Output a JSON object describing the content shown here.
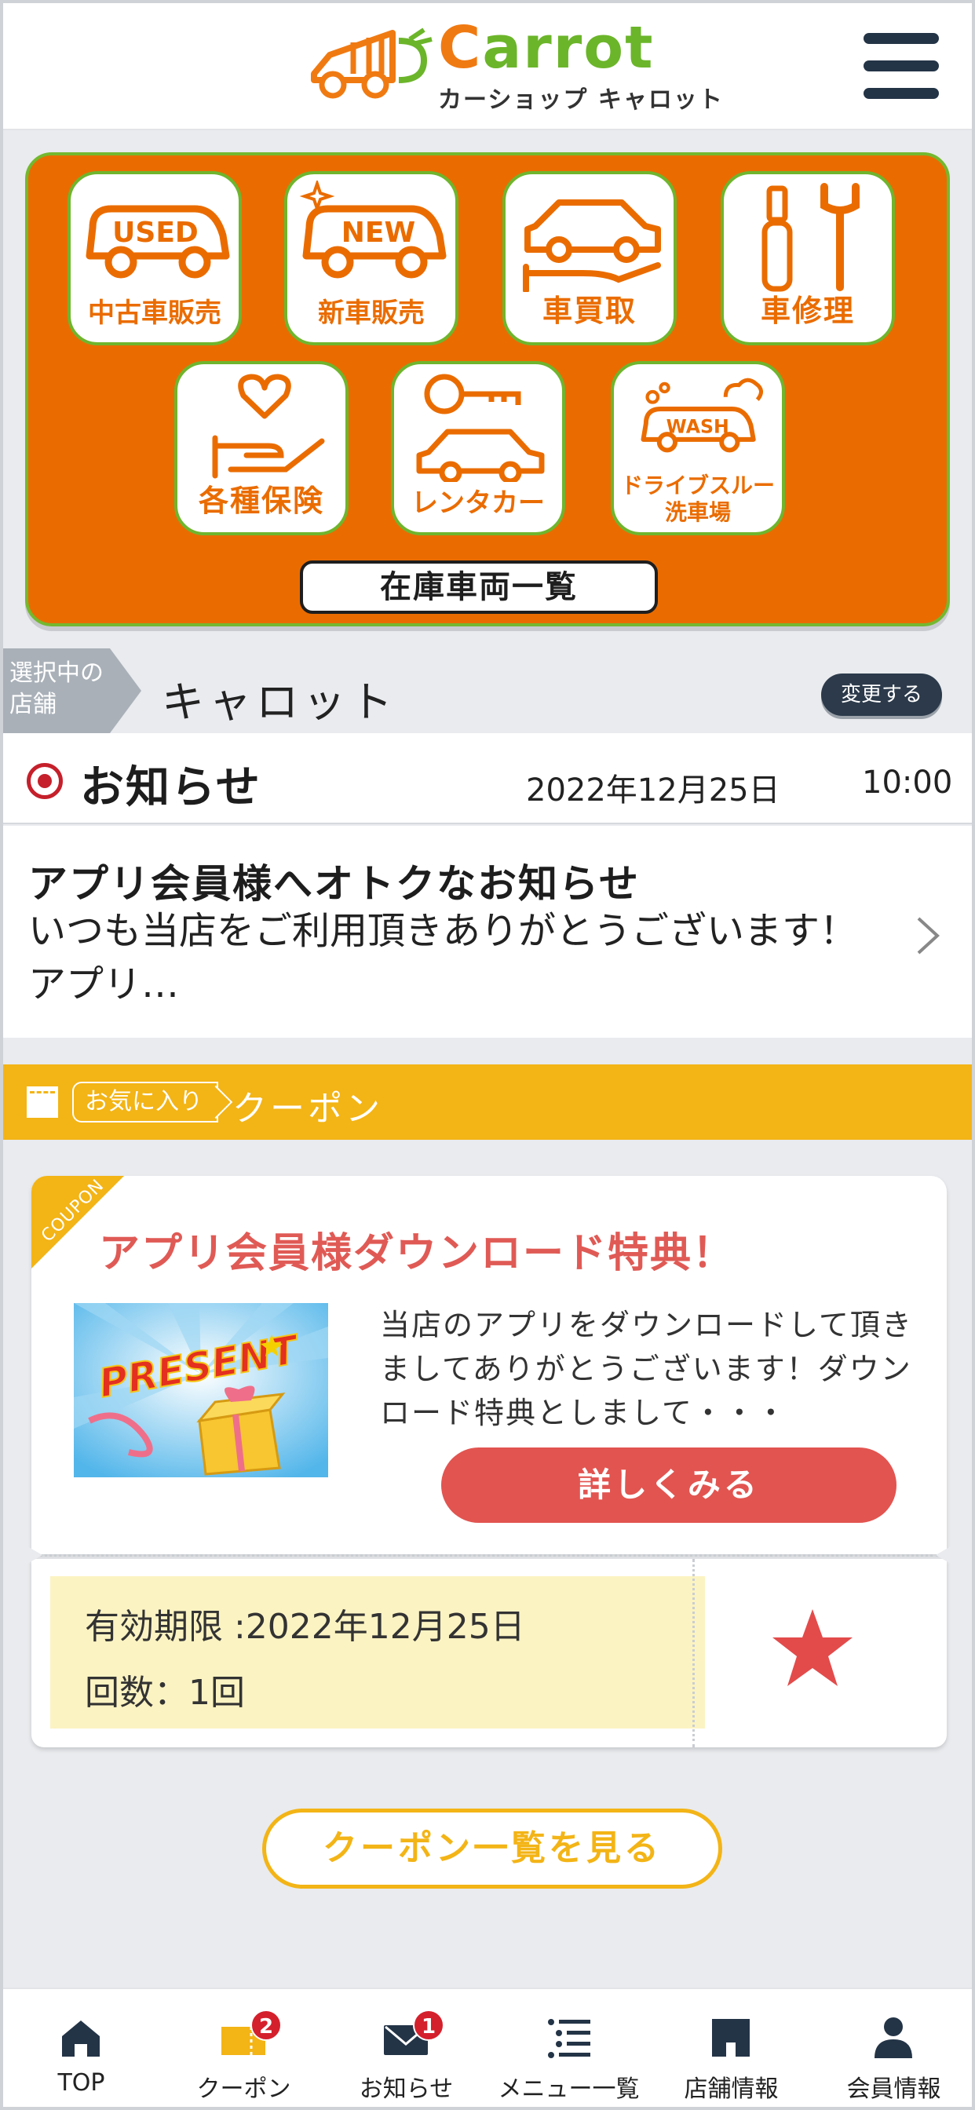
{
  "header": {
    "logo_title": "Carrot",
    "logo_subtitle": "カーショップ キャロット"
  },
  "services": [
    {
      "label": "中古車販売",
      "icon_text": "USED",
      "icon": "used-car-icon"
    },
    {
      "label": "新車販売",
      "icon_text": "NEW",
      "icon": "new-car-icon"
    },
    {
      "label": "車買取",
      "icon": "car-buyback-icon"
    },
    {
      "label": "車修理",
      "icon": "tools-icon"
    },
    {
      "label": "各種保険",
      "icon": "heart-hand-icon"
    },
    {
      "label": "レンタカー",
      "icon": "key-car-icon"
    },
    {
      "label_line1": "ドライブスルー",
      "label_line2": "洗車場",
      "icon_text": "WASH",
      "icon": "car-wash-icon"
    }
  ],
  "stock_button": "在庫車両一覧",
  "store": {
    "tag_line1": "選択中の",
    "tag_line2": "店舗",
    "name": "キャロット",
    "change_label": "変更する"
  },
  "news": {
    "title": "お知らせ",
    "date": "2022年12月25日",
    "time": "10:00",
    "item_title": "アプリ会員様へオトクなお知らせ",
    "item_body": "いつも当店をご利用頂きありがとうございます！アプリ…"
  },
  "coupon_section": {
    "fav_tag": "お気に入り",
    "label": "クーポン"
  },
  "coupon": {
    "corner": "COUPON",
    "title": "アプリ会員様ダウンロード特典！",
    "image_text": "PRESENT",
    "body": "当店のアプリをダウンロードして頂きましてありがとうございます！ダウンロード特典としまして・・・",
    "detail_button": "詳しくみる",
    "expiry": "有効期限 :2022年12月25日",
    "count": "回数：1回"
  },
  "coupon_list_button": "クーポン一覧を見る",
  "tabbar": [
    {
      "label": "TOP",
      "icon": "home-icon"
    },
    {
      "label": "クーポン",
      "icon": "coupon-icon",
      "badge": "2"
    },
    {
      "label": "お知らせ",
      "icon": "mail-icon",
      "badge": "1"
    },
    {
      "label": "メニュー一覧",
      "icon": "menu-list-icon"
    },
    {
      "label": "店舗情報",
      "icon": "store-icon"
    },
    {
      "label": "会員情報",
      "icon": "person-icon"
    }
  ],
  "colors": {
    "brand_orange": "#ea6c00",
    "brand_green": "#6fb52d",
    "coupon_yellow": "#f3b416",
    "accent_red": "#e25450",
    "navy": "#243447"
  }
}
